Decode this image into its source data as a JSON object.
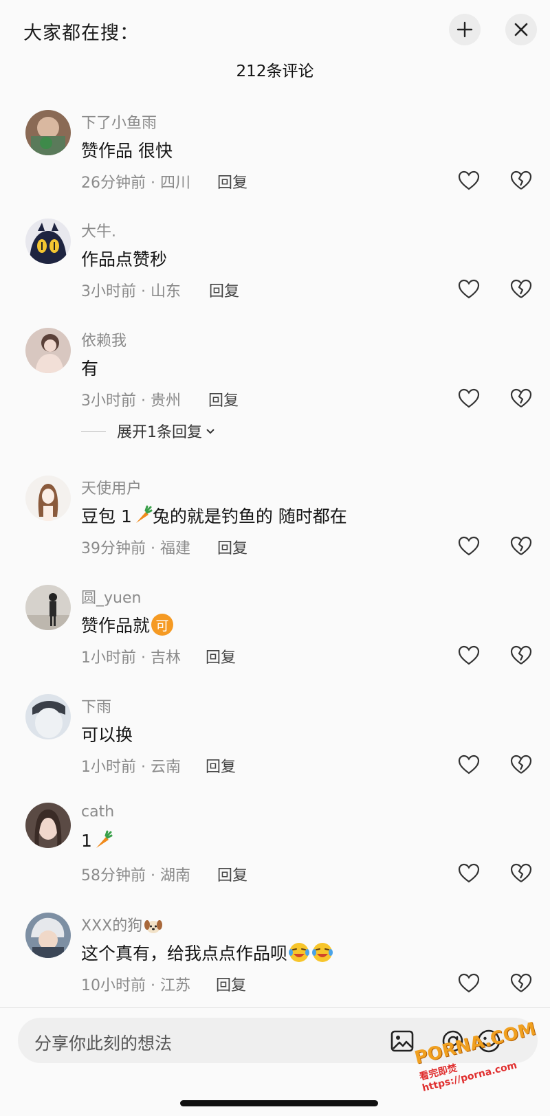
{
  "header": {
    "search_hint": "大家都在搜：",
    "comment_count": "212条评论"
  },
  "comments": [
    {
      "user": "下了小鱼雨",
      "text": "赞作品 很快",
      "emoji": "",
      "meta": "26分钟前 · 四川",
      "reply": "回复"
    },
    {
      "user": "大牛.",
      "text": "作品点赞秒",
      "emoji": "",
      "meta": "3小时前 · 山东",
      "reply": "回复"
    },
    {
      "user": "依赖我",
      "text": "有",
      "emoji": "",
      "meta": "3小时前 · 贵州",
      "reply": "回复",
      "expand": "展开1条回复"
    },
    {
      "user": "天使用户",
      "text": "豆包 1",
      "text_after": " 兔的就是钓鱼的 随时都在",
      "emoji": "carrot",
      "meta": "39分钟前 · 福建",
      "reply": "回复"
    },
    {
      "user": "圆_yuen",
      "text": "赞作品就",
      "emoji": "ke-badge",
      "emoji_text": "可",
      "meta": "1小时前 · 吉林",
      "reply": "回复"
    },
    {
      "user": "下雨",
      "text": "可以换",
      "emoji": "",
      "meta": "1小时前 · 云南",
      "reply": "回复"
    },
    {
      "user": "cath",
      "text": "1",
      "emoji": "carrot",
      "meta": "58分钟前 · 湖南",
      "reply": "回复"
    },
    {
      "user": "XXX的狗",
      "text": "这个真有，给我点点作品呗",
      "emoji": "laugh-cry",
      "meta": "10小时前 · 江苏",
      "reply": "回复"
    }
  ],
  "input": {
    "placeholder": "分享你此刻的想法"
  },
  "watermark": {
    "logo": "PORNA.COM",
    "sub": "看完即焚 https://porna.com"
  },
  "colors": {
    "background": "#fafafa",
    "secondary_text": "#8a8a8a",
    "input_bg": "#efefef"
  }
}
